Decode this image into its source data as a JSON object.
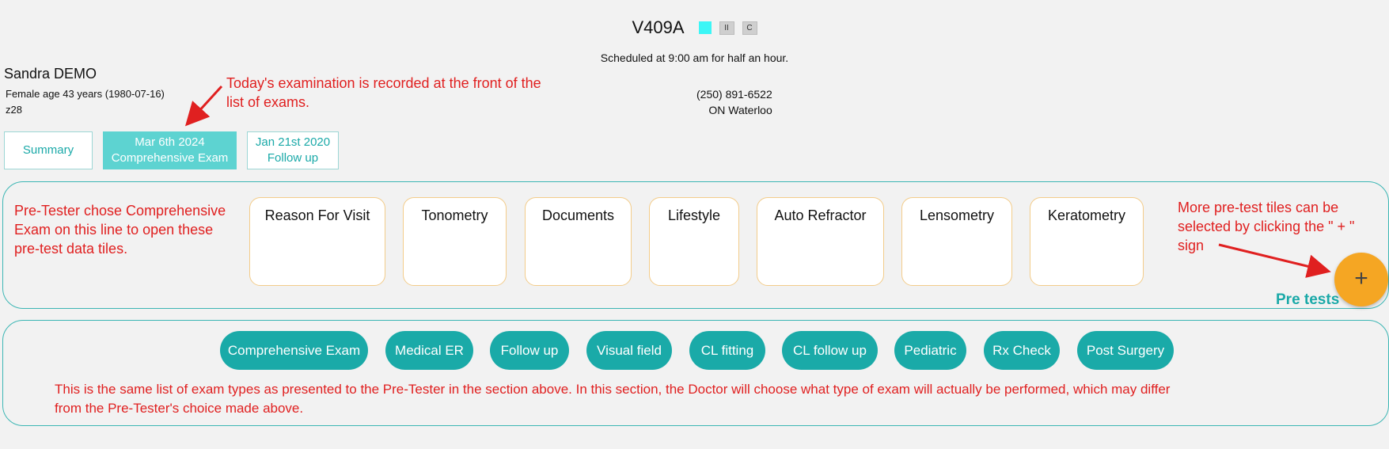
{
  "header": {
    "title": "V409A",
    "status_color": "#3cf6f6",
    "pause_icon": "pause-icon",
    "refresh_icon": "refresh-icon",
    "pause_glyph": "II",
    "refresh_glyph": "C",
    "scheduled": "Scheduled at 9:00 am for half an hour."
  },
  "patient": {
    "name": "Sandra DEMO",
    "details": "Female age 43 years  (1980-07-16)",
    "code": "z28",
    "phone": "(250) 891-6522",
    "location": "ON  Waterloo"
  },
  "exam_tabs": [
    {
      "line1": "Summary",
      "line2": ""
    },
    {
      "line1": "Mar 6th 2024",
      "line2": "Comprehensive Exam"
    },
    {
      "line1": "Jan 21st 2020",
      "line2": "Follow up"
    }
  ],
  "pretest_tiles": [
    "Reason For Visit",
    "Tonometry",
    "Documents",
    "Lifestyle",
    "Auto Refractor",
    "Lensometry",
    "Keratometry"
  ],
  "fab": {
    "symbol": "+",
    "label": "Pre tests"
  },
  "exam_types": [
    "Comprehensive Exam",
    "Medical ER",
    "Follow up",
    "Visual field",
    "CL fitting",
    "CL follow up",
    "Pediatric",
    "Rx Check",
    "Post Surgery"
  ],
  "annotations": {
    "tabs_note_1": "Today's examination is recorded at the front of the",
    "tabs_note_2": "list of exams.",
    "pretester_1": "Pre-Tester chose Comprehensive",
    "pretester_2": "Exam on this line to open these",
    "pretester_3": "pre-test data tiles.",
    "more_1": "More pre-test tiles can be",
    "more_2": "selected by clicking the \" + \"",
    "more_3": "sign",
    "doctor_1": "This is the same list of exam types as presented to the Pre-Tester in the section above.  In this section, the Doctor will choose what type of exam will actually be performed, which may differ",
    "doctor_2": "from the Pre-Tester's choice made above."
  },
  "colors": {
    "teal": "#1aaaa8",
    "annotation": "#e02020",
    "fab": "#f5a623"
  }
}
